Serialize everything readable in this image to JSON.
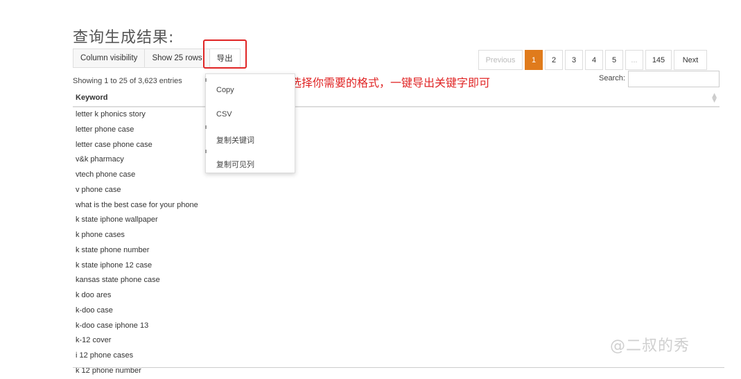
{
  "page_title": "查询生成结果:",
  "toolbar": {
    "column_visibility": "Column visibility",
    "show_rows": "Show 25 rows",
    "export": "导出"
  },
  "info": "Showing 1 to 25 of 3,623 entries",
  "pagination": {
    "previous": "Previous",
    "pages": [
      "1",
      "2",
      "3",
      "4",
      "5",
      "...",
      "145"
    ],
    "active_page": "1",
    "next": "Next"
  },
  "search": {
    "label": "Search:",
    "value": ""
  },
  "table": {
    "header": "Keyword",
    "rows": [
      "letter k phonics story",
      "letter phone case",
      "letter case phone case",
      "v&k pharmacy",
      "vtech phone case",
      "v phone case",
      "what is the best case for your phone",
      "k state iphone wallpaper",
      "k phone cases",
      "k state phone number",
      "k state iphone 12 case",
      "kansas state phone case",
      "k doo ares",
      "k-doo case",
      "k-doo case iphone 13",
      "k-12 cover",
      "i 12 phone cases",
      "k 12 phone number"
    ]
  },
  "dropdown": {
    "items": [
      "Copy",
      "CSV",
      "复制关键词",
      "复制可见列"
    ]
  },
  "annotation": "Step5:选择你需要的格式，一键导出关键字即可",
  "watermark": "@二叔的秀",
  "colors": {
    "accent": "#e07b1c",
    "highlight": "#e02424"
  }
}
